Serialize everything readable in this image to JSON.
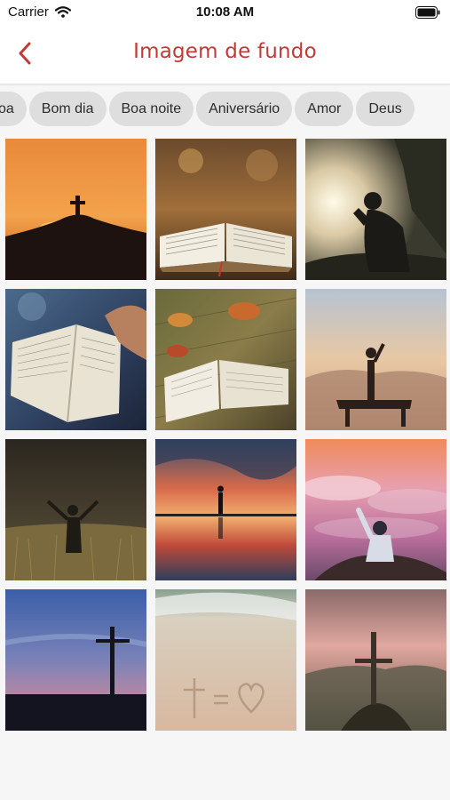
{
  "status_bar": {
    "carrier": "Carrier",
    "time": "10:08 AM"
  },
  "nav": {
    "title": "Imagem de fundo",
    "back_icon": "chevron-left-icon"
  },
  "categories": [
    {
      "label": "coa"
    },
    {
      "label": "Bom dia"
    },
    {
      "label": "Boa noite"
    },
    {
      "label": "Aniversário"
    },
    {
      "label": "Amor"
    },
    {
      "label": "Deus"
    }
  ],
  "images": [
    {
      "name": "cross-on-hill-sunset"
    },
    {
      "name": "open-bible-on-table"
    },
    {
      "name": "man-praying-silhouette"
    },
    {
      "name": "hands-holding-bible"
    },
    {
      "name": "bible-with-autumn-leaves"
    },
    {
      "name": "person-raising-hand-on-cliff"
    },
    {
      "name": "man-arms-raised-in-grass"
    },
    {
      "name": "man-walking-on-water-sunset"
    },
    {
      "name": "man-raising-fist-above-clouds"
    },
    {
      "name": "cross-at-dusk"
    },
    {
      "name": "cross-drawn-in-sand"
    },
    {
      "name": "cross-on-mountain"
    }
  ],
  "colors": {
    "accent": "#c23a35",
    "chip_bg": "#dedede",
    "background": "#f6f6f6"
  }
}
